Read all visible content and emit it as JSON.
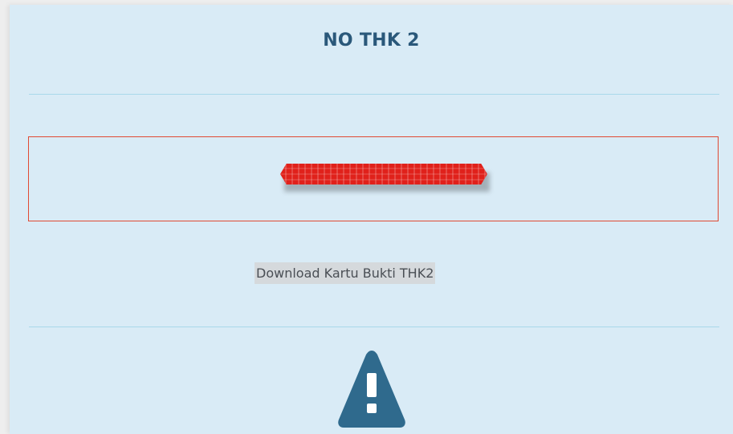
{
  "card": {
    "title": "NO THK 2"
  },
  "number_box": {
    "value_redacted": true
  },
  "download": {
    "label": "Download Kartu Bukti THK2"
  },
  "icons": {
    "warning": "warning-triangle-icon"
  },
  "colors": {
    "card_background": "#d9ebf6",
    "title_text": "#2a587a",
    "box_border": "#e04a33",
    "redaction": "#e0211b",
    "warning_icon": "#2f6a8d",
    "divider": "#a9d8ea"
  }
}
